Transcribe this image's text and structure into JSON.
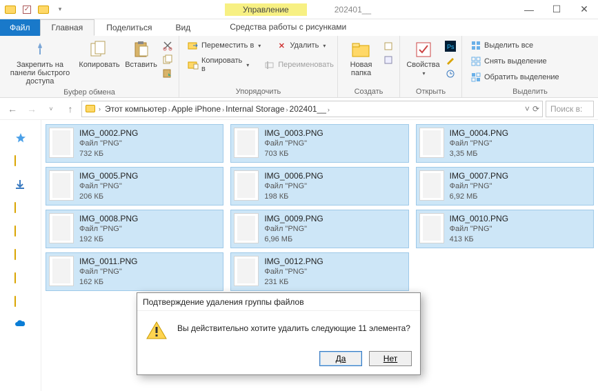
{
  "title": {
    "context_tab": "Управление",
    "window_name": "202401__"
  },
  "tabs": {
    "file": "Файл",
    "home": "Главная",
    "share": "Поделиться",
    "view": "Вид",
    "picture_tools": "Средства работы с рисунками"
  },
  "ribbon": {
    "clipboard": {
      "pin": "Закрепить на панели быстрого доступа",
      "copy": "Копировать",
      "paste": "Вставить",
      "label": "Буфер обмена"
    },
    "organize": {
      "move_to": "Переместить в",
      "copy_to": "Копировать в",
      "delete": "Удалить",
      "rename": "Переименовать",
      "label": "Упорядочить"
    },
    "new": {
      "new_folder": "Новая папка",
      "label": "Создать"
    },
    "open": {
      "properties": "Свойства",
      "label": "Открыть"
    },
    "select": {
      "select_all": "Выделить все",
      "select_none": "Снять выделение",
      "invert": "Обратить выделение",
      "label": "Выделить"
    }
  },
  "breadcrumbs": [
    "Этот компьютер",
    "Apple iPhone",
    "Internal Storage",
    "202401__"
  ],
  "search_placeholder": "Поиск в:",
  "files": [
    {
      "name": "IMG_0002.PNG",
      "type": "Файл \"PNG\"",
      "size": "732 КБ"
    },
    {
      "name": "IMG_0003.PNG",
      "type": "Файл \"PNG\"",
      "size": "703 КБ"
    },
    {
      "name": "IMG_0004.PNG",
      "type": "Файл \"PNG\"",
      "size": "3,35 МБ"
    },
    {
      "name": "IMG_0005.PNG",
      "type": "Файл \"PNG\"",
      "size": "206 КБ"
    },
    {
      "name": "IMG_0006.PNG",
      "type": "Файл \"PNG\"",
      "size": "198 КБ"
    },
    {
      "name": "IMG_0007.PNG",
      "type": "Файл \"PNG\"",
      "size": "6,92 МБ"
    },
    {
      "name": "IMG_0008.PNG",
      "type": "Файл \"PNG\"",
      "size": "192 КБ"
    },
    {
      "name": "IMG_0009.PNG",
      "type": "Файл \"PNG\"",
      "size": "6,96 МБ"
    },
    {
      "name": "IMG_0010.PNG",
      "type": "Файл \"PNG\"",
      "size": "413 КБ"
    },
    {
      "name": "IMG_0011.PNG",
      "type": "Файл \"PNG\"",
      "size": "162 КБ"
    },
    {
      "name": "IMG_0012.PNG",
      "type": "Файл \"PNG\"",
      "size": "231 КБ"
    }
  ],
  "dialog": {
    "title": "Подтверждение удаления группы файлов",
    "message": "Вы действительно хотите удалить следующие 11 элемента?",
    "yes": "Да",
    "no": "Нет"
  }
}
